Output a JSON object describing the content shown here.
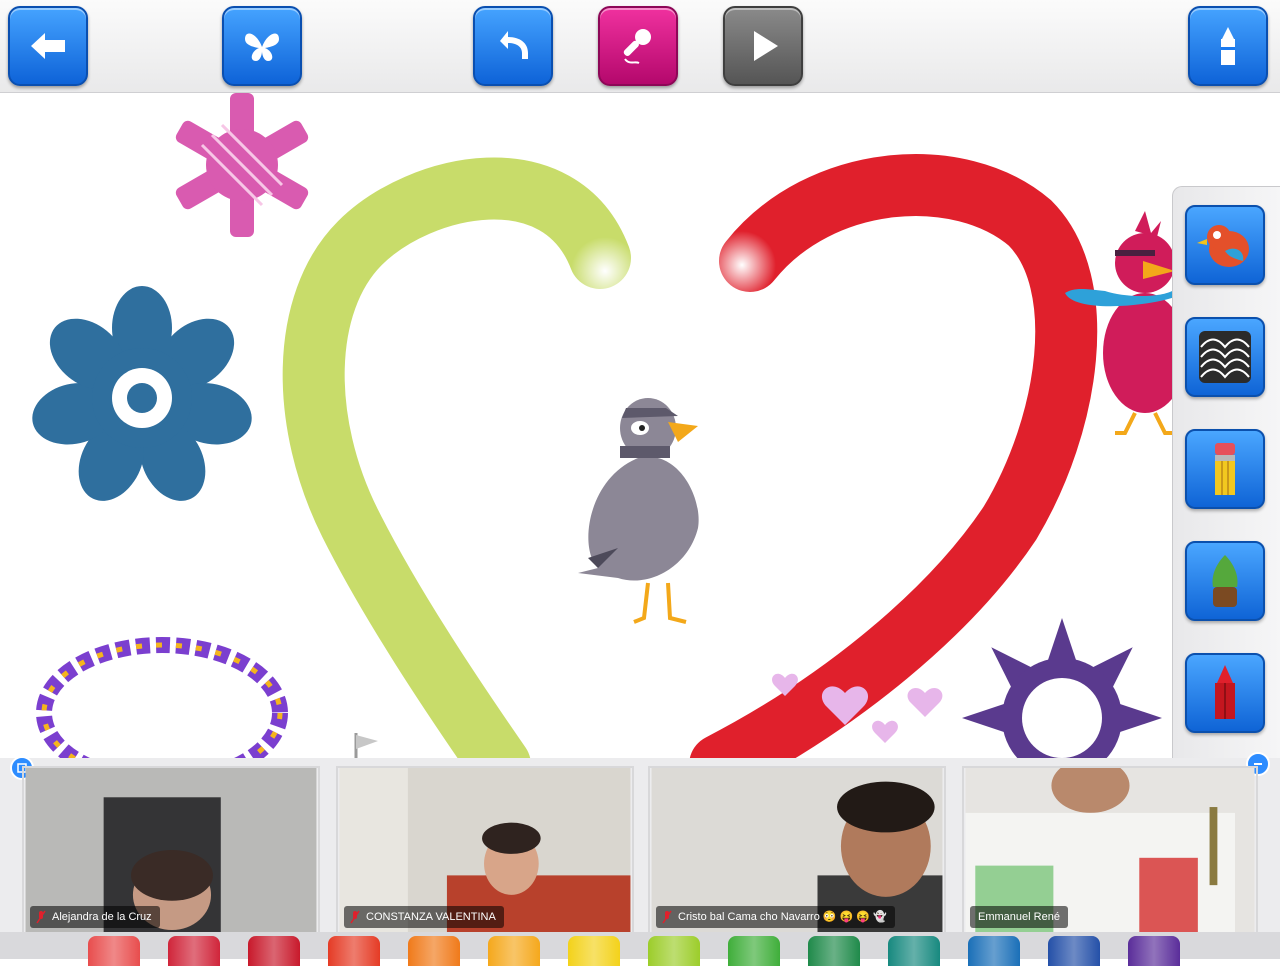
{
  "toolbar": {
    "buttons": [
      {
        "name": "back-button",
        "icon": "arrow-left-icon"
      },
      {
        "name": "stickers-button",
        "icon": "butterfly-icon"
      },
      {
        "name": "undo-button",
        "icon": "undo-arrow-icon"
      },
      {
        "name": "record-button",
        "icon": "microphone-icon"
      },
      {
        "name": "play-button",
        "icon": "play-icon"
      },
      {
        "name": "crayon-button",
        "icon": "crayon-icon"
      }
    ]
  },
  "tools": [
    {
      "name": "stamp-tool",
      "icon": "bird-stamp-icon"
    },
    {
      "name": "pattern-tool",
      "icon": "pattern-icon"
    },
    {
      "name": "pencil-tool",
      "icon": "pencil-icon"
    },
    {
      "name": "brush-tool",
      "icon": "brush-icon"
    },
    {
      "name": "crayon-tool",
      "icon": "red-crayon-icon"
    }
  ],
  "participants": [
    {
      "name": "Alejandra de la Cruz",
      "muted": true
    },
    {
      "name": "CONSTANZA VALENTINA",
      "muted": true
    },
    {
      "name": "Cristo bal Cama cho Navarro 😳 😝 😝 👻",
      "muted": true
    },
    {
      "name": "Emmanuel René",
      "muted": false
    }
  ],
  "colors": {
    "accent_blue": "#1a7af0",
    "record_magenta": "#d31a86",
    "heart_green": "#c8dc6a",
    "heart_red": "#e0202c",
    "snowflake_pink": "#d54aa8",
    "flower_blue": "#2f6f9e",
    "flake_purple": "#5a3a8e"
  },
  "crayon_colors": [
    "#e84d4d",
    "#d0253a",
    "#c8192b",
    "#e53b25",
    "#f07a1a",
    "#f5a81c",
    "#f3d21a",
    "#9ccd2a",
    "#3fae3a",
    "#1f8a4a",
    "#17897f",
    "#1a6fb8",
    "#2450a8",
    "#5a2d9a"
  ]
}
